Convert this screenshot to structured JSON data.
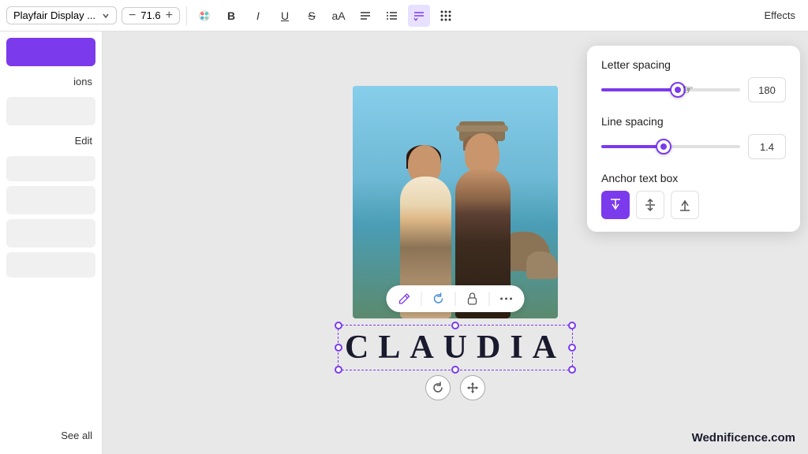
{
  "toolbar": {
    "font_name": "Playfair Display ...",
    "font_size": "71.6",
    "minus_label": "−",
    "plus_label": "+",
    "bold_label": "B",
    "italic_label": "I",
    "underline_label": "U",
    "strikethrough_label": "S",
    "text_size_label": "aA",
    "align_label": "≡",
    "list_label": "≡",
    "spacing_label": "≡",
    "dots_label": "⠿",
    "effects_label": "Effects"
  },
  "sidebar": {
    "nav_label": "ions",
    "edit_label": "Edit",
    "see_all_label": "See all"
  },
  "spacing_panel": {
    "letter_spacing_label": "Letter spacing",
    "letter_spacing_value": "180",
    "letter_slider_pct": 55,
    "line_spacing_label": "Line spacing",
    "line_spacing_value": "1.4",
    "line_slider_pct": 45,
    "anchor_label": "Anchor text box",
    "anchor_top_label": "⬇",
    "anchor_mid_label": "↕",
    "anchor_bottom_label": "↑"
  },
  "canvas": {
    "text_content": "CLAUDIA",
    "watermark": "Wednificence.com"
  },
  "float_toolbar": {
    "pencil_icon": "✏",
    "refresh_icon": "↺",
    "lock_icon": "🔒",
    "more_icon": "⋯"
  },
  "text_controls": {
    "rotate_icon": "↺",
    "move_icon": "✥"
  }
}
